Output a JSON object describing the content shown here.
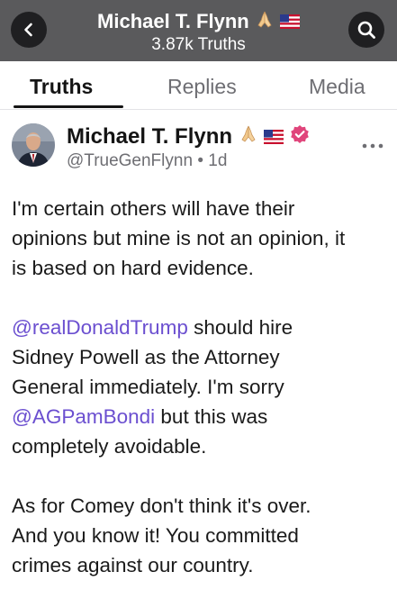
{
  "header": {
    "title": "Michael T. Flynn",
    "subtitle": "3.87k Truths",
    "title_icons": [
      "folded-hands-icon",
      "us-flag-icon"
    ]
  },
  "nav": {
    "back_icon": "chevron-left-icon",
    "search_icon": "search-icon"
  },
  "tabs": [
    {
      "label": "Truths",
      "active": true
    },
    {
      "label": "Replies",
      "active": false
    },
    {
      "label": "Media",
      "active": false
    }
  ],
  "post": {
    "author": {
      "name": "Michael T. Flynn",
      "handle": "@TrueGenFlynn",
      "separator": "•",
      "time": "1d",
      "badges": [
        "folded-hands-icon",
        "us-flag-icon",
        "verified-badge-icon"
      ]
    },
    "paragraphs": [
      {
        "segments": [
          {
            "text": "I'm certain others will have their"
          },
          {
            "text": "opinions but mine is not an opinion, it"
          },
          {
            "text": "is based on hard evidence."
          }
        ]
      },
      {
        "segments": [
          {
            "mention": "@realDonaldTrump",
            "text": " should hire"
          },
          {
            "text": "Sidney Powell as the Attorney"
          },
          {
            "text": "General immediately. I'm sorry"
          },
          {
            "mention": "@AGPamBondi",
            "text": " but this was"
          },
          {
            "text": "completely avoidable."
          }
        ]
      },
      {
        "segments": [
          {
            "text": "As for Comey don't think it's over."
          },
          {
            "text": "And you know it! You committed"
          },
          {
            "text": "crimes against our country."
          }
        ]
      }
    ]
  },
  "colors": {
    "header_bg": "#5a5a5c",
    "circle_button_bg": "#1f1f21",
    "mention": "#6b4fd0",
    "verified": "#e0457b",
    "secondary_text": "#6e6e73"
  }
}
